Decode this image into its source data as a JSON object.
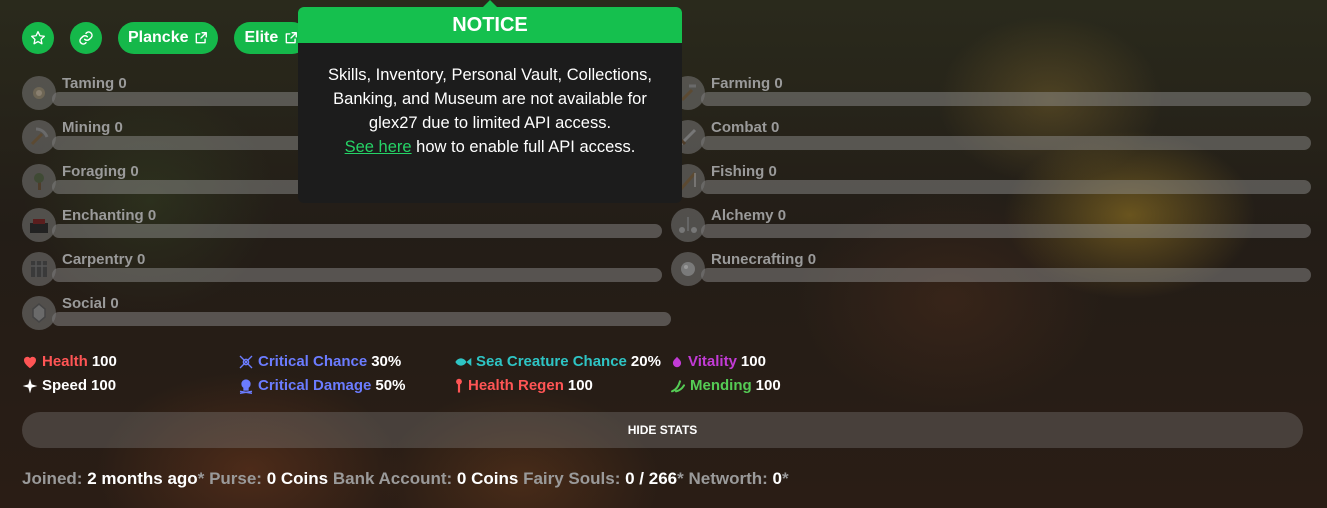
{
  "top": {
    "buttons": [
      {
        "label": "Plancke"
      },
      {
        "label": "Elite"
      }
    ]
  },
  "skills": {
    "left": [
      {
        "name": "Taming",
        "level": "0"
      },
      {
        "name": "Mining",
        "level": "0"
      },
      {
        "name": "Foraging",
        "level": "0"
      },
      {
        "name": "Enchanting",
        "level": "0"
      },
      {
        "name": "Carpentry",
        "level": "0"
      },
      {
        "name": "Social",
        "level": "0"
      }
    ],
    "right": [
      {
        "name": "Farming",
        "level": "0"
      },
      {
        "name": "Combat",
        "level": "0"
      },
      {
        "name": "Fishing",
        "level": "0"
      },
      {
        "name": "Alchemy",
        "level": "0"
      },
      {
        "name": "Runecrafting",
        "level": "0"
      }
    ]
  },
  "stats": [
    {
      "name": "Health",
      "value": "100",
      "color": "#ff5555",
      "icon": "heart-icon"
    },
    {
      "name": "Speed",
      "value": "100",
      "color": "#ffffff",
      "icon": "sparkle-icon"
    },
    {
      "name": "Critical Chance",
      "value": "30%",
      "color": "#6b7cff",
      "icon": "crit-chance-icon"
    },
    {
      "name": "Critical Damage",
      "value": "50%",
      "color": "#6b7cff",
      "icon": "skull-icon"
    },
    {
      "name": "Sea Creature Chance",
      "value": "20%",
      "color": "#2ec4c4",
      "icon": "fish-icon"
    },
    {
      "name": "Health Regen",
      "value": "100",
      "color": "#ff5555",
      "icon": "regen-icon"
    },
    {
      "name": "Vitality",
      "value": "100",
      "color": "#c23bd6",
      "icon": "vitality-icon"
    },
    {
      "name": "Mending",
      "value": "100",
      "color": "#55cc55",
      "icon": "mending-icon"
    }
  ],
  "hide_stats_label": "HIDE STATS",
  "footer": {
    "joined_label": "Joined:",
    "joined_value": "2 months ago",
    "joined_star": "*",
    "purse_label": "Purse:",
    "purse_value": "0 Coins",
    "bank_label": "Bank Account:",
    "bank_value": "0 Coins",
    "fairy_label": "Fairy Souls:",
    "fairy_value": "0 / 266",
    "fairy_star": "*",
    "networth_label": "Networth:",
    "networth_value": "0",
    "networth_star": "*"
  },
  "notice": {
    "title": "NOTICE",
    "message": "Skills, Inventory, Personal Vault, Collections, Banking, and Museum are not available for glex27 due to limited API access.",
    "link_text": "See here",
    "link_suffix": " how to enable full API access."
  },
  "colors": {
    "accent": "#15b84a",
    "link": "#25d366"
  }
}
